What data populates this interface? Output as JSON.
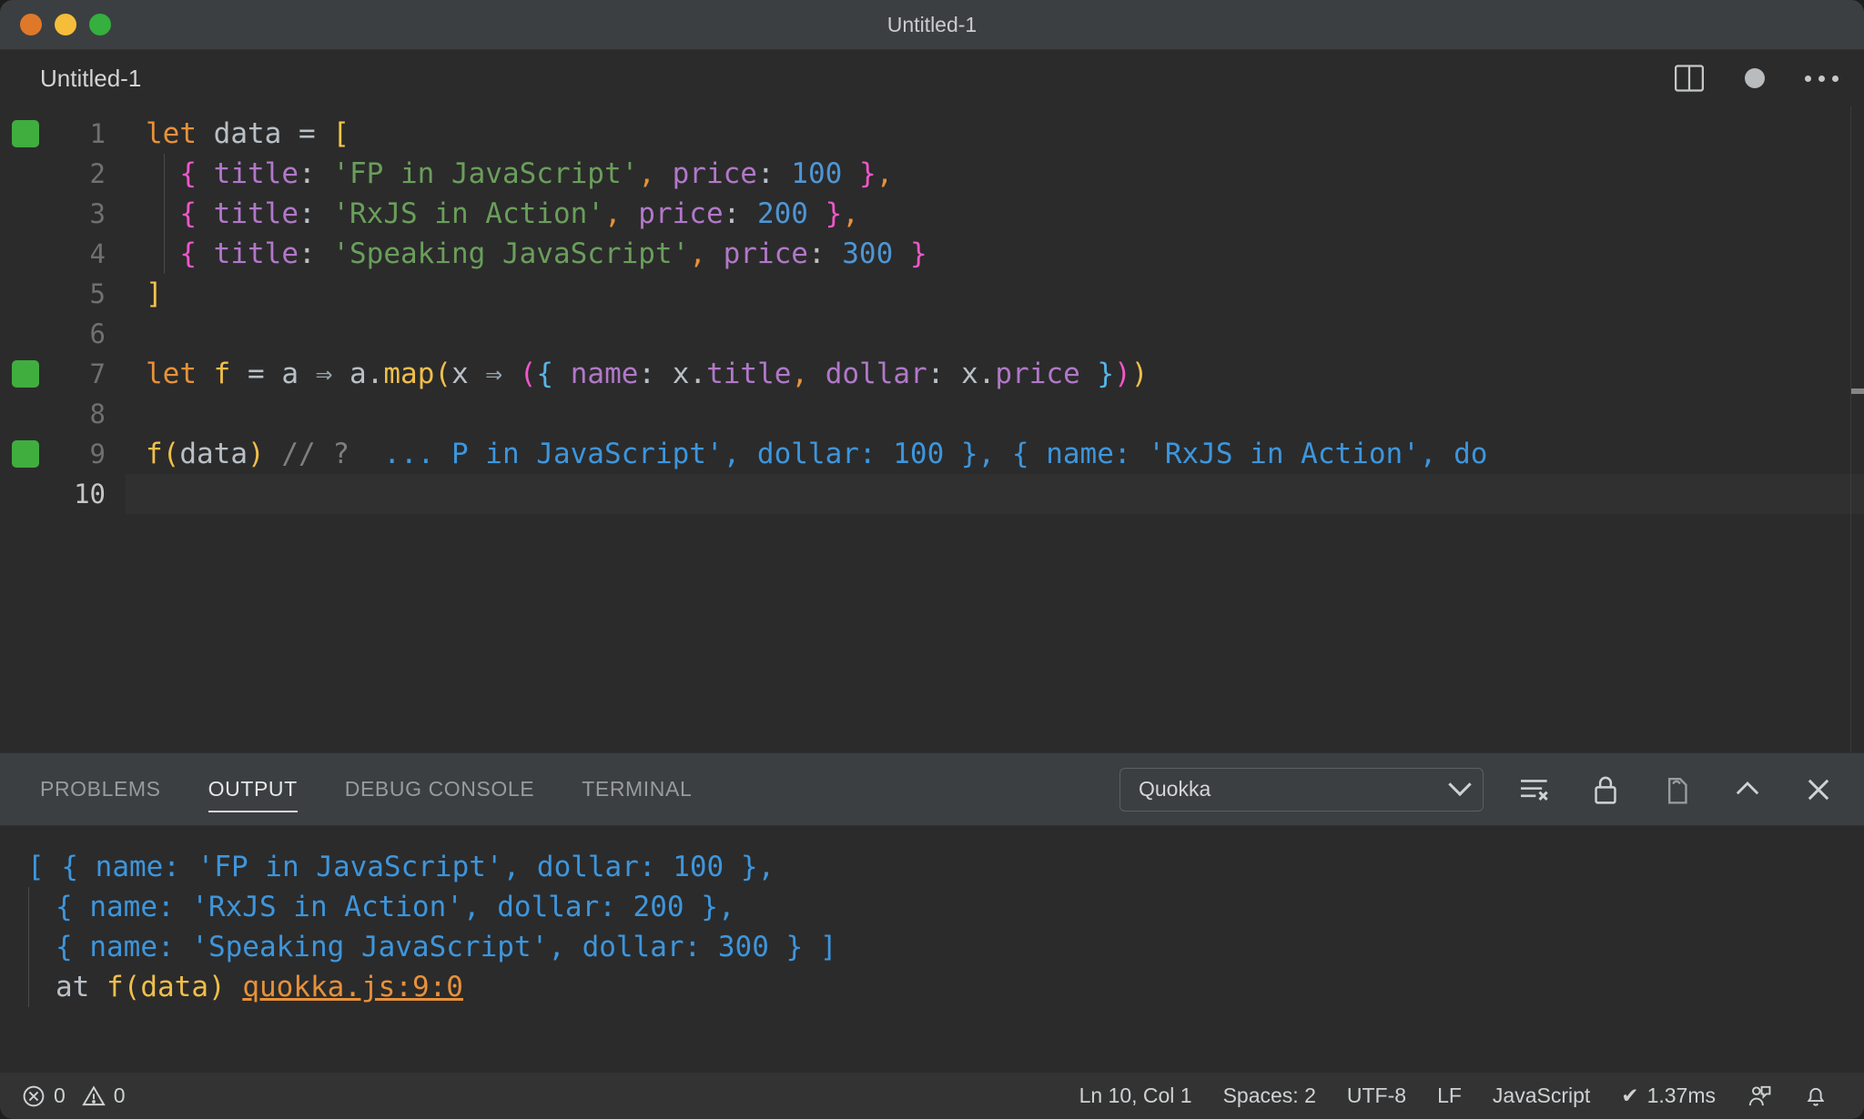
{
  "window": {
    "title": "Untitled-1",
    "traffic_lights": [
      "close-red",
      "minimize-yellow",
      "maximize-green"
    ]
  },
  "editor": {
    "tab_label": "Untitled-1",
    "actions": [
      "split-editor-icon",
      "unsaved-dot",
      "more-actions-icon"
    ],
    "language": "JavaScript",
    "lines": [
      {
        "number": "1",
        "breakpoint": true,
        "tokens": [
          {
            "t": "let",
            "c": "kw"
          },
          {
            "t": " ",
            "c": "plain"
          },
          {
            "t": "data",
            "c": "plain"
          },
          {
            "t": " ",
            "c": "plain"
          },
          {
            "t": "=",
            "c": "plain"
          },
          {
            "t": " ",
            "c": "plain"
          },
          {
            "t": "[",
            "c": "brk"
          }
        ]
      },
      {
        "number": "2",
        "breakpoint": false,
        "tokens": [
          {
            "t": "  ",
            "c": "plain"
          },
          {
            "t": "{",
            "c": "brace"
          },
          {
            "t": " ",
            "c": "plain"
          },
          {
            "t": "title",
            "c": "prop"
          },
          {
            "t": ": ",
            "c": "plain"
          },
          {
            "t": "'FP in JavaScript'",
            "c": "str"
          },
          {
            "t": ",",
            "c": "comma"
          },
          {
            "t": " ",
            "c": "plain"
          },
          {
            "t": "price",
            "c": "prop"
          },
          {
            "t": ": ",
            "c": "plain"
          },
          {
            "t": "100",
            "c": "num"
          },
          {
            "t": " ",
            "c": "plain"
          },
          {
            "t": "}",
            "c": "brace"
          },
          {
            "t": ",",
            "c": "comma"
          }
        ]
      },
      {
        "number": "3",
        "breakpoint": false,
        "tokens": [
          {
            "t": "  ",
            "c": "plain"
          },
          {
            "t": "{",
            "c": "brace"
          },
          {
            "t": " ",
            "c": "plain"
          },
          {
            "t": "title",
            "c": "prop"
          },
          {
            "t": ": ",
            "c": "plain"
          },
          {
            "t": "'RxJS in Action'",
            "c": "str"
          },
          {
            "t": ",",
            "c": "comma"
          },
          {
            "t": " ",
            "c": "plain"
          },
          {
            "t": "price",
            "c": "prop"
          },
          {
            "t": ": ",
            "c": "plain"
          },
          {
            "t": "200",
            "c": "num"
          },
          {
            "t": " ",
            "c": "plain"
          },
          {
            "t": "}",
            "c": "brace"
          },
          {
            "t": ",",
            "c": "comma"
          }
        ]
      },
      {
        "number": "4",
        "breakpoint": false,
        "tokens": [
          {
            "t": "  ",
            "c": "plain"
          },
          {
            "t": "{",
            "c": "brace"
          },
          {
            "t": " ",
            "c": "plain"
          },
          {
            "t": "title",
            "c": "prop"
          },
          {
            "t": ": ",
            "c": "plain"
          },
          {
            "t": "'Speaking JavaScript'",
            "c": "str"
          },
          {
            "t": ",",
            "c": "comma"
          },
          {
            "t": " ",
            "c": "plain"
          },
          {
            "t": "price",
            "c": "prop"
          },
          {
            "t": ": ",
            "c": "plain"
          },
          {
            "t": "300",
            "c": "num"
          },
          {
            "t": " ",
            "c": "plain"
          },
          {
            "t": "}",
            "c": "brace"
          }
        ]
      },
      {
        "number": "5",
        "breakpoint": false,
        "tokens": [
          {
            "t": "]",
            "c": "brk"
          }
        ]
      },
      {
        "number": "6",
        "breakpoint": false,
        "tokens": []
      },
      {
        "number": "7",
        "breakpoint": true,
        "tokens": [
          {
            "t": "let",
            "c": "kw"
          },
          {
            "t": " ",
            "c": "plain"
          },
          {
            "t": "f",
            "c": "fn"
          },
          {
            "t": " ",
            "c": "plain"
          },
          {
            "t": "=",
            "c": "plain"
          },
          {
            "t": " ",
            "c": "plain"
          },
          {
            "t": "a",
            "c": "plain"
          },
          {
            "t": " ",
            "c": "plain"
          },
          {
            "t": "⇒",
            "c": "arrow"
          },
          {
            "t": " ",
            "c": "plain"
          },
          {
            "t": "a",
            "c": "plain"
          },
          {
            "t": ".",
            "c": "plain"
          },
          {
            "t": "map",
            "c": "fn"
          },
          {
            "t": "(",
            "c": "paren"
          },
          {
            "t": "x",
            "c": "plain"
          },
          {
            "t": " ",
            "c": "plain"
          },
          {
            "t": "⇒",
            "c": "arrow"
          },
          {
            "t": " ",
            "c": "plain"
          },
          {
            "t": "(",
            "c": "brace"
          },
          {
            "t": "{",
            "c": "cbrace"
          },
          {
            "t": " ",
            "c": "plain"
          },
          {
            "t": "name",
            "c": "prop"
          },
          {
            "t": ": ",
            "c": "plain"
          },
          {
            "t": "x",
            "c": "plain"
          },
          {
            "t": ".",
            "c": "plain"
          },
          {
            "t": "title",
            "c": "prop"
          },
          {
            "t": ",",
            "c": "comma"
          },
          {
            "t": " ",
            "c": "plain"
          },
          {
            "t": "dollar",
            "c": "prop"
          },
          {
            "t": ": ",
            "c": "plain"
          },
          {
            "t": "x",
            "c": "plain"
          },
          {
            "t": ".",
            "c": "plain"
          },
          {
            "t": "price",
            "c": "prop"
          },
          {
            "t": " ",
            "c": "plain"
          },
          {
            "t": "}",
            "c": "cbrace"
          },
          {
            "t": ")",
            "c": "brace"
          },
          {
            "t": ")",
            "c": "paren"
          }
        ]
      },
      {
        "number": "8",
        "breakpoint": false,
        "tokens": []
      },
      {
        "number": "9",
        "breakpoint": true,
        "tokens": [
          {
            "t": "f",
            "c": "fn"
          },
          {
            "t": "(",
            "c": "paren"
          },
          {
            "t": "data",
            "c": "plain"
          },
          {
            "t": ")",
            "c": "paren"
          },
          {
            "t": " ",
            "c": "plain"
          },
          {
            "t": "// ?",
            "c": "cmt"
          },
          {
            "t": "  ",
            "c": "plain"
          },
          {
            "t": "... P in JavaScript', dollar: 100 }, { name: 'RxJS in Action', do",
            "c": "res"
          }
        ]
      },
      {
        "number": "10",
        "breakpoint": false,
        "active": true,
        "tokens": []
      }
    ]
  },
  "panel": {
    "tabs": [
      {
        "label": "PROBLEMS",
        "active": false
      },
      {
        "label": "OUTPUT",
        "active": true
      },
      {
        "label": "DEBUG CONSOLE",
        "active": false
      },
      {
        "label": "TERMINAL",
        "active": false
      }
    ],
    "channel_select": {
      "value": "Quokka"
    },
    "actions": [
      "clear-output-icon",
      "lock-scroll-icon",
      "open-in-editor-icon",
      "collapse-panel-icon",
      "close-panel-icon"
    ],
    "output_lines": [
      {
        "indent": false,
        "segments": [
          {
            "t": "[ { name: 'FP in JavaScript', dollar: 100 },",
            "c": "res"
          }
        ]
      },
      {
        "indent": true,
        "segments": [
          {
            "t": "{ name: 'RxJS in Action', dollar: 200 },",
            "c": "res"
          }
        ]
      },
      {
        "indent": true,
        "segments": [
          {
            "t": "{ name: 'Speaking JavaScript', dollar: 300 } ]",
            "c": "res"
          }
        ]
      },
      {
        "indent": true,
        "segments": [
          {
            "t": "at ",
            "c": "at"
          },
          {
            "t": "f(data)",
            "c": "ofn"
          },
          {
            "t": " ",
            "c": "at"
          },
          {
            "t": "quokka.js:9:0",
            "c": "link"
          }
        ]
      }
    ]
  },
  "statusbar": {
    "errors": "0",
    "warnings": "0",
    "cursor": "Ln 10, Col 1",
    "indentation": "Spaces: 2",
    "encoding": "UTF-8",
    "eol": "LF",
    "language": "JavaScript",
    "quokka_time": "1.37ms",
    "quokka_check": "✔",
    "right_icons": [
      "feedback-icon",
      "notifications-bell-icon"
    ]
  },
  "colors": {
    "editor_bg": "#2b2b2b",
    "chrome_bg": "#3b3f41",
    "status_bg": "#333333",
    "breakpoint_green": "#3fae3f",
    "result_blue": "#3d96dd",
    "link_orange": "#e8913a"
  }
}
